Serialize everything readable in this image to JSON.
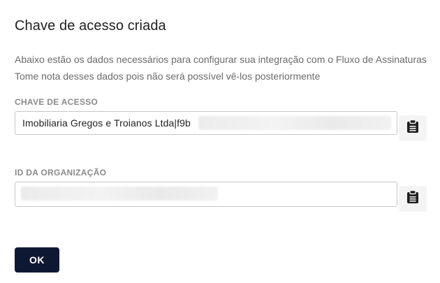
{
  "dialog": {
    "title": "Chave de acesso criada",
    "description_line1": "Abaixo estão os dados necessários para configurar sua integração com o Fluxo de Assinaturas",
    "description_line2": "Tome nota desses dados pois não será possível vê-los posteriormente"
  },
  "access_key": {
    "label": "CHAVE DE ACESSO",
    "value": "Imobiliaria Gregos e Troianos Ltda|f9b",
    "copy_icon": "clipboard-icon"
  },
  "organization_id": {
    "label": "ID DA ORGANIZAÇÃO",
    "value": "",
    "copy_icon": "clipboard-icon"
  },
  "actions": {
    "ok_label": "OK"
  },
  "colors": {
    "primary_button": "#0f1833",
    "label_gray": "#8a8a8a",
    "text_gray": "#6b6b6b"
  }
}
